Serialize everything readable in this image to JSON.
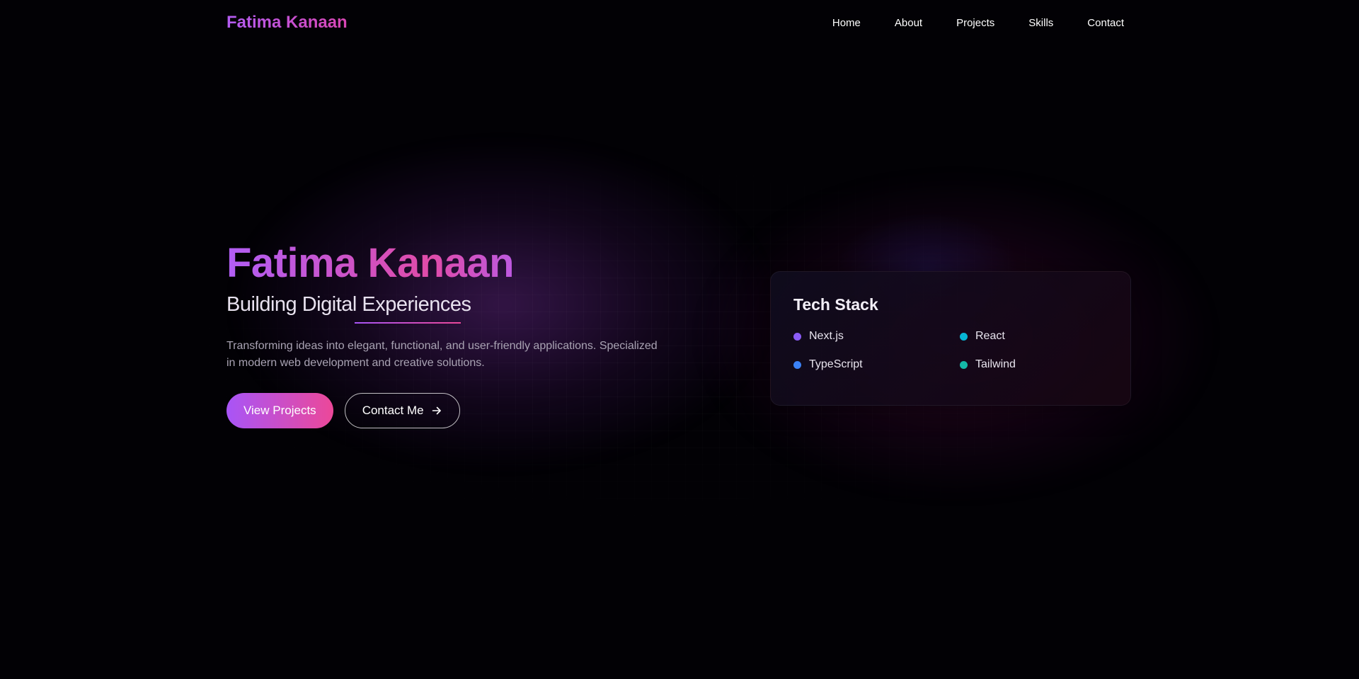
{
  "header": {
    "logo": "Fatima Kanaan",
    "nav": [
      "Home",
      "About",
      "Projects",
      "Skills",
      "Contact"
    ]
  },
  "hero": {
    "title": "Fatima Kanaan",
    "subtitle": "Building Digital Experiences",
    "description": "Transforming ideas into elegant, functional, and user-friendly applications. Specialized in modern web development and creative solutions.",
    "primary_button": "View Projects",
    "secondary_button": "Contact Me",
    "secondary_button_icon": "arrow-right-icon"
  },
  "tech_stack": {
    "title": "Tech Stack",
    "items": [
      {
        "label": "Next.js",
        "color": "#8b5cf6"
      },
      {
        "label": "React",
        "color": "#06b6d4"
      },
      {
        "label": "TypeScript",
        "color": "#3b82f6"
      },
      {
        "label": "Tailwind",
        "color": "#14b8a6"
      }
    ]
  },
  "colors": {
    "accent_purple": "#a855f7",
    "accent_pink": "#ec4899",
    "background": "#020105"
  }
}
